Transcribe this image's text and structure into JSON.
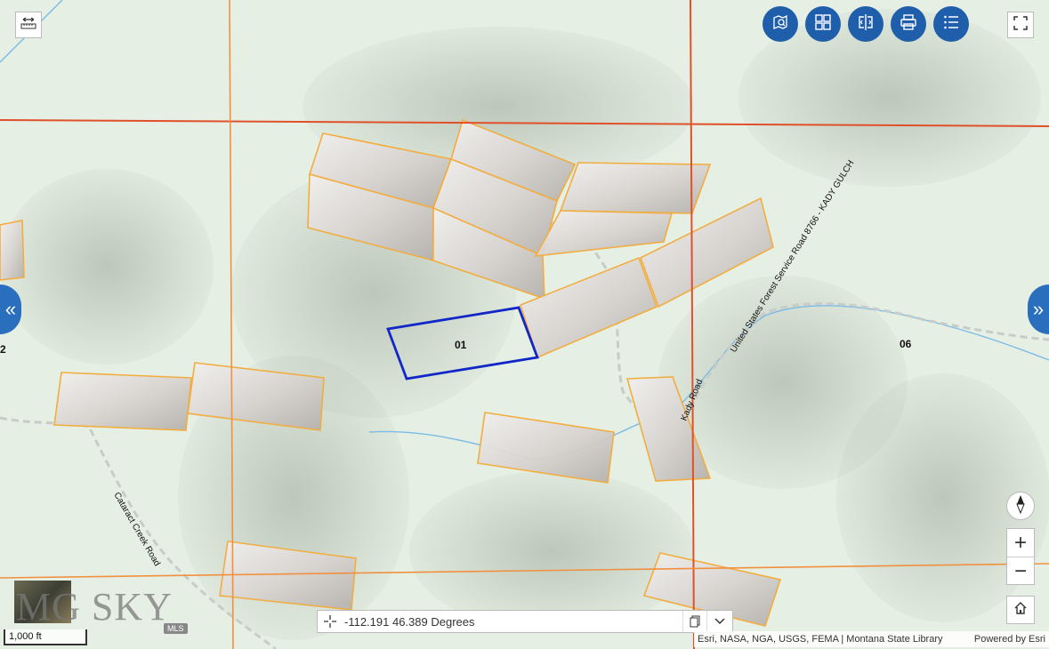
{
  "map": {
    "parcel_labels": [
      "01",
      "06",
      "2"
    ],
    "road_labels": [
      "United States Forest Service Road 8766 - KADY GULCH",
      "Kady Road",
      "Cataract Creek Road"
    ],
    "colors": {
      "background": "#e6efe3",
      "parcel_fill": "#e8e4e2",
      "parcel_outline": "#f2ad40",
      "selected_outline": "#1227c8",
      "section_line": "#e0502a",
      "stream": "#7cbbe6",
      "toolbar_button": "#1f5eaa"
    }
  },
  "toolbar": {
    "buttons": [
      {
        "name": "search-location-icon"
      },
      {
        "name": "basemap-gallery-icon"
      },
      {
        "name": "compare-icon"
      },
      {
        "name": "print-icon"
      },
      {
        "name": "layer-list-icon"
      }
    ],
    "measure_icon": "measure-icon",
    "fullscreen_icon": "fullscreen-icon"
  },
  "logo": {
    "text": "MG SKY",
    "sub": "MLS"
  },
  "coordinates": {
    "value": "-112.191 46.389 Degrees"
  },
  "scale": {
    "label": "1,000 ft"
  },
  "attribution": {
    "sources": "Esri, NASA, NGA, USGS, FEMA | Montana State Library",
    "powered": "Powered by Esri"
  },
  "zoom": {
    "in_label": "+",
    "out_label": "−"
  }
}
